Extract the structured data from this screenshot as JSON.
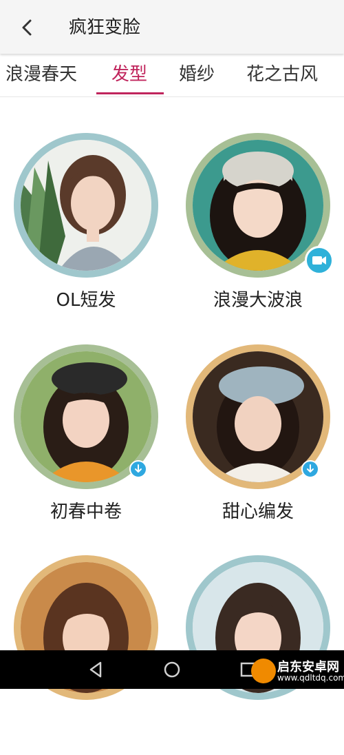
{
  "header": {
    "title": "疯狂变脸"
  },
  "tabs": [
    {
      "label": "浪漫春天"
    },
    {
      "label": "发型"
    },
    {
      "label": "婚纱"
    },
    {
      "label": "花之古风"
    }
  ],
  "active_tab": "发型",
  "styles": [
    {
      "label": "OL短发",
      "ring_color": "#9fc7cc"
    },
    {
      "label": "浪漫大波浪",
      "ring_color": "#a7bf95"
    },
    {
      "label": "初春中卷",
      "ring_color": "#a7bf95"
    },
    {
      "label": "甜心编发",
      "ring_color": "#e2b879"
    },
    {
      "label": "",
      "ring_color": "#e2b879"
    },
    {
      "label": "",
      "ring_color": "#9fc7cc"
    }
  ],
  "watermark": {
    "title": "启东安卓网",
    "url": "www.qdltdq.com"
  },
  "colors": {
    "accent": "#c0245c",
    "badge": "#2fa8e0"
  }
}
